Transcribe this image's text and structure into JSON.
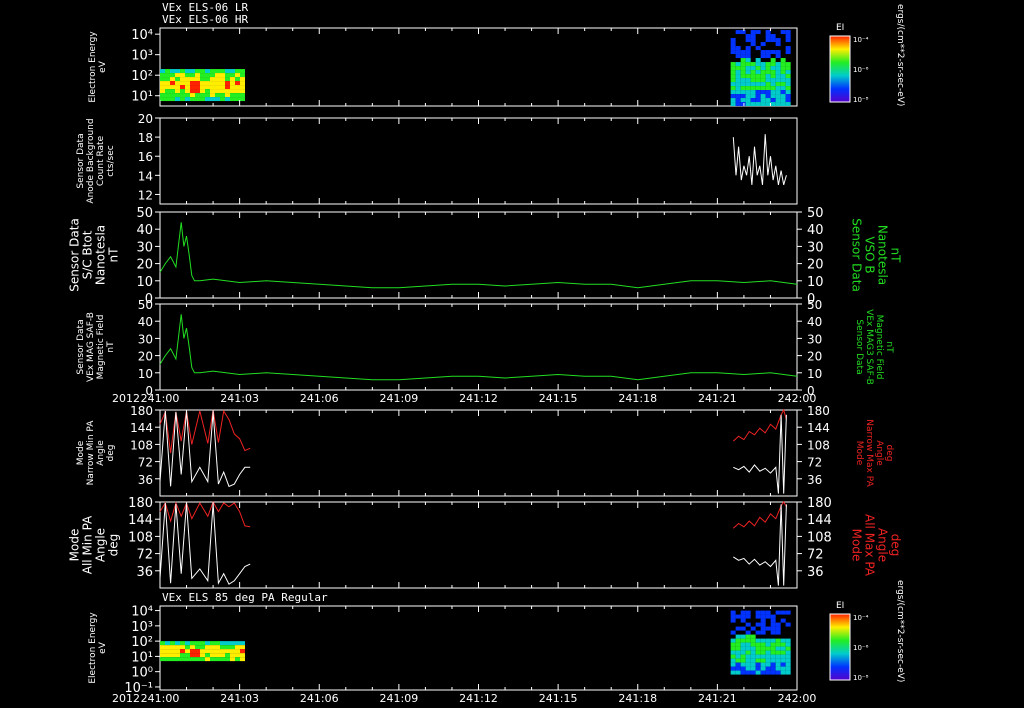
{
  "header": {
    "line1": "VEx ELS-06 LR",
    "line2": "VEx ELS-06 HR",
    "bottom_title": "VEx ELS 85 deg PA Regular"
  },
  "colorbar": {
    "label": "EI",
    "unit_label": "ergs/(cm**2-sr-sec-eV)",
    "tick_labels": [
      "10⁻⁴",
      "10⁻⁶",
      "10⁻⁸"
    ]
  },
  "time_axis": {
    "year": "2012",
    "tick_labels": [
      "241:00",
      "241:03",
      "241:06",
      "241:09",
      "241:12",
      "241:15",
      "241:18",
      "241:21",
      "242:00"
    ]
  },
  "colors": {
    "white": "#ffffff",
    "green": "#22dd22",
    "red": "#ee2222",
    "frame": "#ffffff"
  },
  "chart_data": [
    {
      "type": "heatmap",
      "panel": "energy_lr",
      "ylabel": [
        "Electron Energy",
        "eV"
      ],
      "y_tick_labels": [
        "10⁴",
        "10³",
        "10²",
        "10¹"
      ],
      "yscale": "log",
      "ylim_log10": [
        0.5,
        4.3
      ],
      "blocks": [
        {
          "x_range": [
            0,
            3.1
          ],
          "e_log10": [
            0.9,
            2.3
          ]
        },
        {
          "x_range": [
            21.5,
            23.6
          ],
          "e_log10": [
            0.6,
            4.2
          ]
        }
      ]
    },
    {
      "type": "line",
      "panel": "background",
      "ylabel": [
        "Sensor Data",
        "Anode Background",
        "Count Rate",
        "cts/sec"
      ],
      "ylim": [
        11,
        20
      ],
      "y_ticks": [
        12,
        14,
        16,
        18,
        20
      ],
      "series": [
        {
          "color": "#ffffff",
          "x": [
            21.6,
            21.7,
            21.8,
            21.9,
            22.0,
            22.1,
            22.2,
            22.3,
            22.4,
            22.5,
            22.6,
            22.7,
            22.8,
            22.9,
            23.0,
            23.1,
            23.2,
            23.3,
            23.4,
            23.5,
            23.6
          ],
          "y": [
            18,
            14,
            17,
            13.5,
            15,
            14,
            16,
            13,
            17,
            14,
            15,
            13,
            18.3,
            14,
            16,
            13.5,
            15,
            13,
            14.5,
            13,
            14
          ]
        }
      ]
    },
    {
      "type": "line",
      "panel": "bmag_sc",
      "ylabel": [
        "Sensor Data",
        "S/C Btot",
        "Nanotesla",
        "nT"
      ],
      "ylabel_right": [
        "Sensor Data",
        "VSO B",
        "Nanotesla",
        "nT"
      ],
      "ylim": [
        0,
        50
      ],
      "y_ticks": [
        0,
        10,
        20,
        30,
        40,
        50
      ],
      "series": [
        {
          "color": "#22dd22",
          "x": [
            0,
            0.2,
            0.4,
            0.6,
            0.8,
            0.9,
            1.0,
            1.1,
            1.2,
            1.3,
            1.5,
            2,
            3,
            4,
            5,
            6,
            7,
            8,
            9,
            10,
            11,
            12,
            13,
            14,
            15,
            16,
            17,
            18,
            19,
            20,
            21,
            22,
            23,
            24
          ],
          "y": [
            15,
            20,
            24,
            18,
            44,
            30,
            36,
            25,
            13,
            10,
            10,
            11,
            9,
            10,
            9,
            8,
            7,
            6,
            6,
            7,
            8,
            8,
            7,
            8,
            9,
            8,
            8,
            6,
            8,
            10,
            10,
            9,
            10,
            8
          ]
        }
      ]
    },
    {
      "type": "line",
      "panel": "bmag_saf",
      "ylabel": [
        "Sensor Data",
        "VEx MAG SAF-B",
        "Magnetic Field",
        "nT"
      ],
      "ylabel_right": [
        "Sensor Data",
        "VEx MAG3 SAF-B",
        "Magnetic Field",
        "nT"
      ],
      "ylim": [
        0,
        50
      ],
      "y_ticks": [
        0,
        10,
        20,
        30,
        40,
        50
      ],
      "series": [
        {
          "color": "#22dd22",
          "x": [
            0,
            0.2,
            0.4,
            0.6,
            0.8,
            0.9,
            1.0,
            1.1,
            1.2,
            1.3,
            1.5,
            2,
            3,
            4,
            5,
            6,
            7,
            8,
            9,
            10,
            11,
            12,
            13,
            14,
            15,
            16,
            17,
            18,
            19,
            20,
            21,
            22,
            23,
            24
          ],
          "y": [
            15,
            20,
            24,
            18,
            44,
            30,
            36,
            25,
            13,
            10,
            10,
            11,
            9,
            10,
            9,
            8,
            7,
            6,
            6,
            7,
            8,
            8,
            7,
            8,
            9,
            8,
            8,
            6,
            8,
            10,
            10,
            9,
            10,
            8
          ]
        }
      ]
    },
    {
      "type": "line",
      "panel": "pa_narrow",
      "ylabel": [
        "Mode",
        "Narrow Min PA",
        "Angle",
        "deg"
      ],
      "ylabel_right": [
        "Mode",
        "Narrow Max PA",
        "Angle",
        "deg"
      ],
      "ylim": [
        0,
        180
      ],
      "y_ticks": [
        36,
        72,
        108,
        144,
        180
      ],
      "series": [
        {
          "color": "#ee2222",
          "x": [
            0,
            0.2,
            0.4,
            0.6,
            0.8,
            1.0,
            1.2,
            1.5,
            1.8,
            2.0,
            2.2,
            2.4,
            2.6,
            2.8,
            3.0,
            3.2,
            3.4
          ],
          "y": [
            150,
            176,
            90,
            176,
            115,
            178,
            108,
            178,
            110,
            180,
            112,
            178,
            160,
            130,
            120,
            95,
            100
          ]
        },
        {
          "color": "#ffffff",
          "x": [
            0,
            0.2,
            0.4,
            0.6,
            0.8,
            1.0,
            1.2,
            1.5,
            1.8,
            2.0,
            2.2,
            2.4,
            2.6,
            2.8,
            3.0,
            3.2,
            3.4
          ],
          "y": [
            30,
            178,
            20,
            176,
            45,
            178,
            30,
            60,
            30,
            176,
            25,
            50,
            20,
            25,
            45,
            60,
            60
          ]
        },
        {
          "color": "#ee2222",
          "x": [
            21.6,
            21.8,
            22.0,
            22.2,
            22.4,
            22.6,
            22.8,
            23.0,
            23.2,
            23.4,
            23.5,
            23.6
          ],
          "y": [
            115,
            125,
            118,
            135,
            128,
            142,
            132,
            150,
            140,
            170,
            180,
            160
          ]
        },
        {
          "color": "#ffffff",
          "x": [
            21.6,
            21.8,
            22.0,
            22.2,
            22.4,
            22.6,
            22.8,
            23.0,
            23.2,
            23.3,
            23.4,
            23.5,
            23.6
          ],
          "y": [
            60,
            55,
            62,
            50,
            65,
            52,
            58,
            48,
            60,
            5,
            170,
            5,
            170
          ]
        }
      ]
    },
    {
      "type": "line",
      "panel": "pa_all",
      "ylabel": [
        "Mode",
        "All Min PA",
        "Angle",
        "deg"
      ],
      "ylabel_right": [
        "Mode",
        "All Max PA",
        "Angle",
        "deg"
      ],
      "ylim": [
        0,
        180
      ],
      "y_ticks": [
        36,
        72,
        108,
        144,
        180
      ],
      "series": [
        {
          "color": "#ee2222",
          "x": [
            0,
            0.2,
            0.4,
            0.6,
            0.8,
            1.0,
            1.2,
            1.5,
            1.8,
            2.0,
            2.2,
            2.4,
            2.6,
            2.8,
            3.0,
            3.2,
            3.4
          ],
          "y": [
            160,
            178,
            140,
            178,
            150,
            178,
            145,
            178,
            150,
            180,
            160,
            178,
            170,
            178,
            160,
            130,
            128
          ]
        },
        {
          "color": "#ffffff",
          "x": [
            0,
            0.2,
            0.4,
            0.6,
            0.8,
            1.0,
            1.2,
            1.5,
            1.8,
            2.0,
            2.2,
            2.4,
            2.6,
            2.8,
            3.0,
            3.2,
            3.4
          ],
          "y": [
            20,
            178,
            10,
            176,
            30,
            178,
            20,
            40,
            15,
            176,
            10,
            30,
            8,
            15,
            30,
            45,
            50
          ]
        },
        {
          "color": "#ee2222",
          "x": [
            21.6,
            21.8,
            22.0,
            22.2,
            22.4,
            22.6,
            22.8,
            23.0,
            23.2,
            23.4,
            23.5,
            23.6
          ],
          "y": [
            125,
            135,
            128,
            140,
            130,
            148,
            138,
            155,
            145,
            172,
            180,
            170
          ]
        },
        {
          "color": "#ffffff",
          "x": [
            21.6,
            21.8,
            22.0,
            22.2,
            22.4,
            22.6,
            22.8,
            23.0,
            23.2,
            23.3,
            23.4,
            23.5,
            23.6
          ],
          "y": [
            65,
            58,
            62,
            50,
            60,
            48,
            55,
            45,
            58,
            5,
            175,
            5,
            175
          ]
        }
      ]
    },
    {
      "type": "heatmap",
      "panel": "energy_85pa",
      "ylabel": [
        "Electron Energy",
        "eV"
      ],
      "y_tick_labels": [
        "10⁴",
        "10³",
        "10²",
        "10¹",
        "10⁰",
        "10⁻¹"
      ],
      "yscale": "log",
      "ylim_log10": [
        -1.2,
        4.3
      ],
      "blocks": [
        {
          "x_range": [
            0,
            3.1
          ],
          "e_log10": [
            0.8,
            2.0
          ]
        },
        {
          "x_range": [
            21.5,
            23.6
          ],
          "e_log10": [
            0.0,
            4.0
          ]
        }
      ]
    }
  ]
}
